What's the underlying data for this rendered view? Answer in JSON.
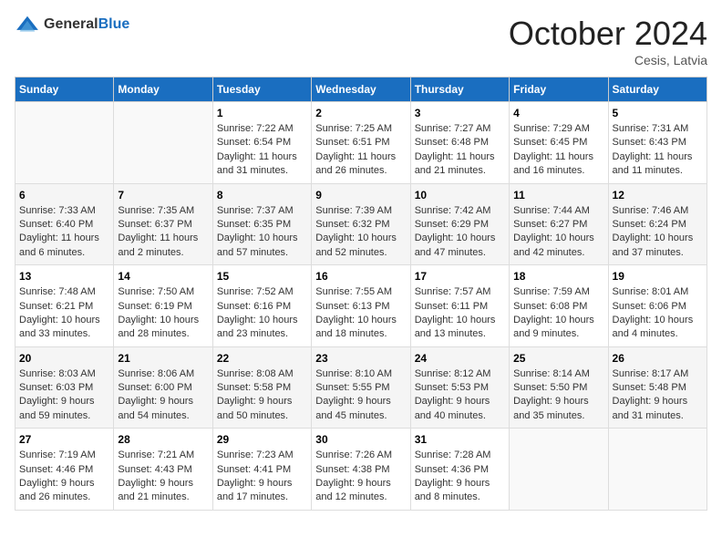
{
  "header": {
    "logo_general": "General",
    "logo_blue": "Blue",
    "month_title": "October 2024",
    "location": "Cesis, Latvia"
  },
  "weekdays": [
    "Sunday",
    "Monday",
    "Tuesday",
    "Wednesday",
    "Thursday",
    "Friday",
    "Saturday"
  ],
  "weeks": [
    [
      {
        "day": "",
        "info": ""
      },
      {
        "day": "",
        "info": ""
      },
      {
        "day": "1",
        "info": "Sunrise: 7:22 AM\nSunset: 6:54 PM\nDaylight: 11 hours and 31 minutes."
      },
      {
        "day": "2",
        "info": "Sunrise: 7:25 AM\nSunset: 6:51 PM\nDaylight: 11 hours and 26 minutes."
      },
      {
        "day": "3",
        "info": "Sunrise: 7:27 AM\nSunset: 6:48 PM\nDaylight: 11 hours and 21 minutes."
      },
      {
        "day": "4",
        "info": "Sunrise: 7:29 AM\nSunset: 6:45 PM\nDaylight: 11 hours and 16 minutes."
      },
      {
        "day": "5",
        "info": "Sunrise: 7:31 AM\nSunset: 6:43 PM\nDaylight: 11 hours and 11 minutes."
      }
    ],
    [
      {
        "day": "6",
        "info": "Sunrise: 7:33 AM\nSunset: 6:40 PM\nDaylight: 11 hours and 6 minutes."
      },
      {
        "day": "7",
        "info": "Sunrise: 7:35 AM\nSunset: 6:37 PM\nDaylight: 11 hours and 2 minutes."
      },
      {
        "day": "8",
        "info": "Sunrise: 7:37 AM\nSunset: 6:35 PM\nDaylight: 10 hours and 57 minutes."
      },
      {
        "day": "9",
        "info": "Sunrise: 7:39 AM\nSunset: 6:32 PM\nDaylight: 10 hours and 52 minutes."
      },
      {
        "day": "10",
        "info": "Sunrise: 7:42 AM\nSunset: 6:29 PM\nDaylight: 10 hours and 47 minutes."
      },
      {
        "day": "11",
        "info": "Sunrise: 7:44 AM\nSunset: 6:27 PM\nDaylight: 10 hours and 42 minutes."
      },
      {
        "day": "12",
        "info": "Sunrise: 7:46 AM\nSunset: 6:24 PM\nDaylight: 10 hours and 37 minutes."
      }
    ],
    [
      {
        "day": "13",
        "info": "Sunrise: 7:48 AM\nSunset: 6:21 PM\nDaylight: 10 hours and 33 minutes."
      },
      {
        "day": "14",
        "info": "Sunrise: 7:50 AM\nSunset: 6:19 PM\nDaylight: 10 hours and 28 minutes."
      },
      {
        "day": "15",
        "info": "Sunrise: 7:52 AM\nSunset: 6:16 PM\nDaylight: 10 hours and 23 minutes."
      },
      {
        "day": "16",
        "info": "Sunrise: 7:55 AM\nSunset: 6:13 PM\nDaylight: 10 hours and 18 minutes."
      },
      {
        "day": "17",
        "info": "Sunrise: 7:57 AM\nSunset: 6:11 PM\nDaylight: 10 hours and 13 minutes."
      },
      {
        "day": "18",
        "info": "Sunrise: 7:59 AM\nSunset: 6:08 PM\nDaylight: 10 hours and 9 minutes."
      },
      {
        "day": "19",
        "info": "Sunrise: 8:01 AM\nSunset: 6:06 PM\nDaylight: 10 hours and 4 minutes."
      }
    ],
    [
      {
        "day": "20",
        "info": "Sunrise: 8:03 AM\nSunset: 6:03 PM\nDaylight: 9 hours and 59 minutes."
      },
      {
        "day": "21",
        "info": "Sunrise: 8:06 AM\nSunset: 6:00 PM\nDaylight: 9 hours and 54 minutes."
      },
      {
        "day": "22",
        "info": "Sunrise: 8:08 AM\nSunset: 5:58 PM\nDaylight: 9 hours and 50 minutes."
      },
      {
        "day": "23",
        "info": "Sunrise: 8:10 AM\nSunset: 5:55 PM\nDaylight: 9 hours and 45 minutes."
      },
      {
        "day": "24",
        "info": "Sunrise: 8:12 AM\nSunset: 5:53 PM\nDaylight: 9 hours and 40 minutes."
      },
      {
        "day": "25",
        "info": "Sunrise: 8:14 AM\nSunset: 5:50 PM\nDaylight: 9 hours and 35 minutes."
      },
      {
        "day": "26",
        "info": "Sunrise: 8:17 AM\nSunset: 5:48 PM\nDaylight: 9 hours and 31 minutes."
      }
    ],
    [
      {
        "day": "27",
        "info": "Sunrise: 7:19 AM\nSunset: 4:46 PM\nDaylight: 9 hours and 26 minutes."
      },
      {
        "day": "28",
        "info": "Sunrise: 7:21 AM\nSunset: 4:43 PM\nDaylight: 9 hours and 21 minutes."
      },
      {
        "day": "29",
        "info": "Sunrise: 7:23 AM\nSunset: 4:41 PM\nDaylight: 9 hours and 17 minutes."
      },
      {
        "day": "30",
        "info": "Sunrise: 7:26 AM\nSunset: 4:38 PM\nDaylight: 9 hours and 12 minutes."
      },
      {
        "day": "31",
        "info": "Sunrise: 7:28 AM\nSunset: 4:36 PM\nDaylight: 9 hours and 8 minutes."
      },
      {
        "day": "",
        "info": ""
      },
      {
        "day": "",
        "info": ""
      }
    ]
  ]
}
